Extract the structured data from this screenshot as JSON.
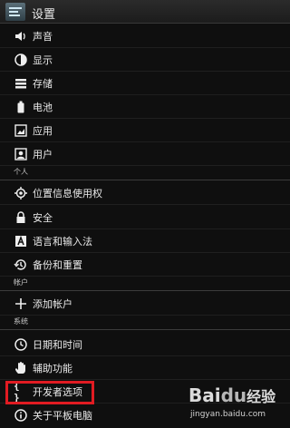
{
  "header": {
    "title": "设置"
  },
  "items": {
    "sound": "声音",
    "display": "显示",
    "storage": "存储",
    "battery": "电池",
    "apps": "应用",
    "users": "用户",
    "personal_header": "个人",
    "location": "位置信息使用权",
    "security": "安全",
    "language": "语言和输入法",
    "backup": "备份和重置",
    "accounts_header": "帐户",
    "add_account": "添加帐户",
    "system_header": "系统",
    "datetime": "日期和时间",
    "accessibility": "辅助功能",
    "developer": "开发者选项",
    "about": "关于平板电脑"
  },
  "highlight_color": "#e11b22",
  "watermark": {
    "logo_text_1": "Bai",
    "logo_text_2": "du",
    "logo_text_3": "经验",
    "url": "jingyan.baidu.com"
  }
}
